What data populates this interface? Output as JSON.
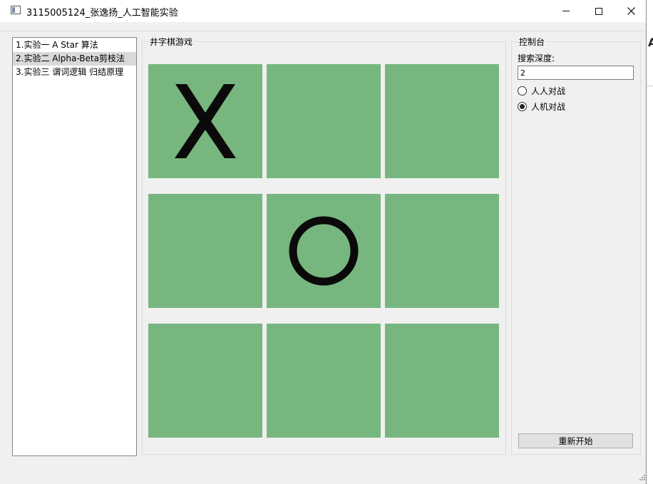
{
  "window": {
    "title": "3115005124_张逸扬_人工智能实验"
  },
  "experiments": {
    "items": [
      {
        "label": "1.实验一  A Star 算法"
      },
      {
        "label": "2.实验二  Alpha-Beta剪枝法"
      },
      {
        "label": "3.实验三  谓词逻辑 归结原理"
      }
    ],
    "selected_index": 1
  },
  "game": {
    "group_label": "井字棋游戏",
    "board": [
      "X",
      "",
      "",
      "",
      "O",
      "",
      "",
      "",
      ""
    ],
    "cell_color": "#77b77f"
  },
  "console": {
    "group_label": "控制台",
    "depth_label": "搜索深度:",
    "depth_value": "2",
    "mode_options": [
      {
        "label": "人人对战",
        "checked": false
      },
      {
        "label": "人机对战",
        "checked": true
      }
    ],
    "restart_label": "重新开始"
  },
  "background": {
    "right_edge_text": "A"
  }
}
